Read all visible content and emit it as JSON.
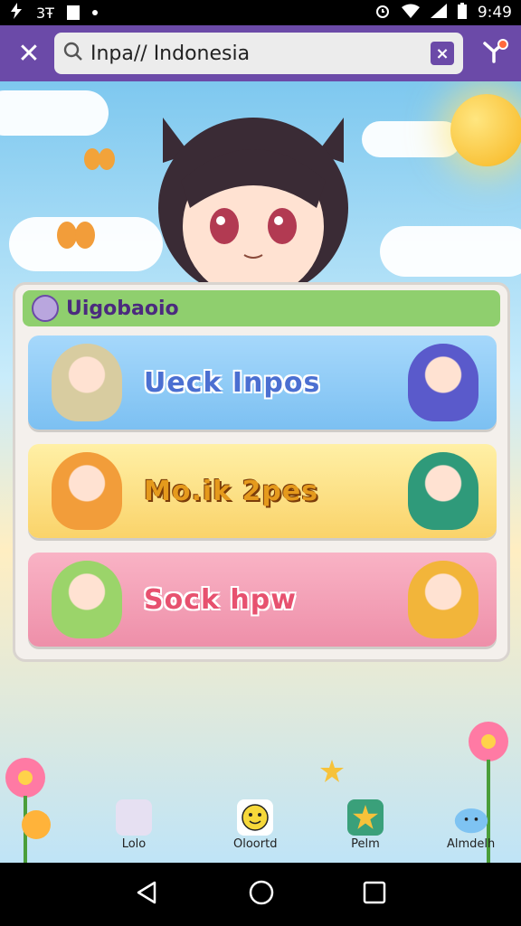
{
  "status_bar": {
    "left_glyph": "3Ŧ",
    "time": "9:49"
  },
  "search": {
    "value": "Inpa// Indonesia",
    "clear_label": "×",
    "close_label": "✕"
  },
  "card": {
    "title": "Uigobaoio",
    "options": [
      {
        "label": "Ueck Inpos"
      },
      {
        "label": "Mo.ik 2pes"
      },
      {
        "label": "Sock hpw"
      }
    ]
  },
  "bottom_nav": {
    "items": [
      {
        "label": "Lolo"
      },
      {
        "label": "Oloortd"
      },
      {
        "label": "Pelm"
      },
      {
        "label": "Almdelh"
      }
    ]
  },
  "colors": {
    "top_bar": "#6b4aa8",
    "card_header": "#8fcf6e",
    "option_blue": "#7cc0f2",
    "option_yellow": "#fad36a",
    "option_pink": "#ee8fa9"
  },
  "icons": [
    "bolt-icon",
    "sim-icon",
    "square-icon",
    "dot-icon",
    "alarm-icon",
    "wifi-icon",
    "signal-icon",
    "battery-icon",
    "search-icon",
    "close-icon",
    "clear-icon",
    "menu-icon",
    "star-icon",
    "smile-icon",
    "back-icon",
    "home-icon",
    "recents-icon"
  ]
}
